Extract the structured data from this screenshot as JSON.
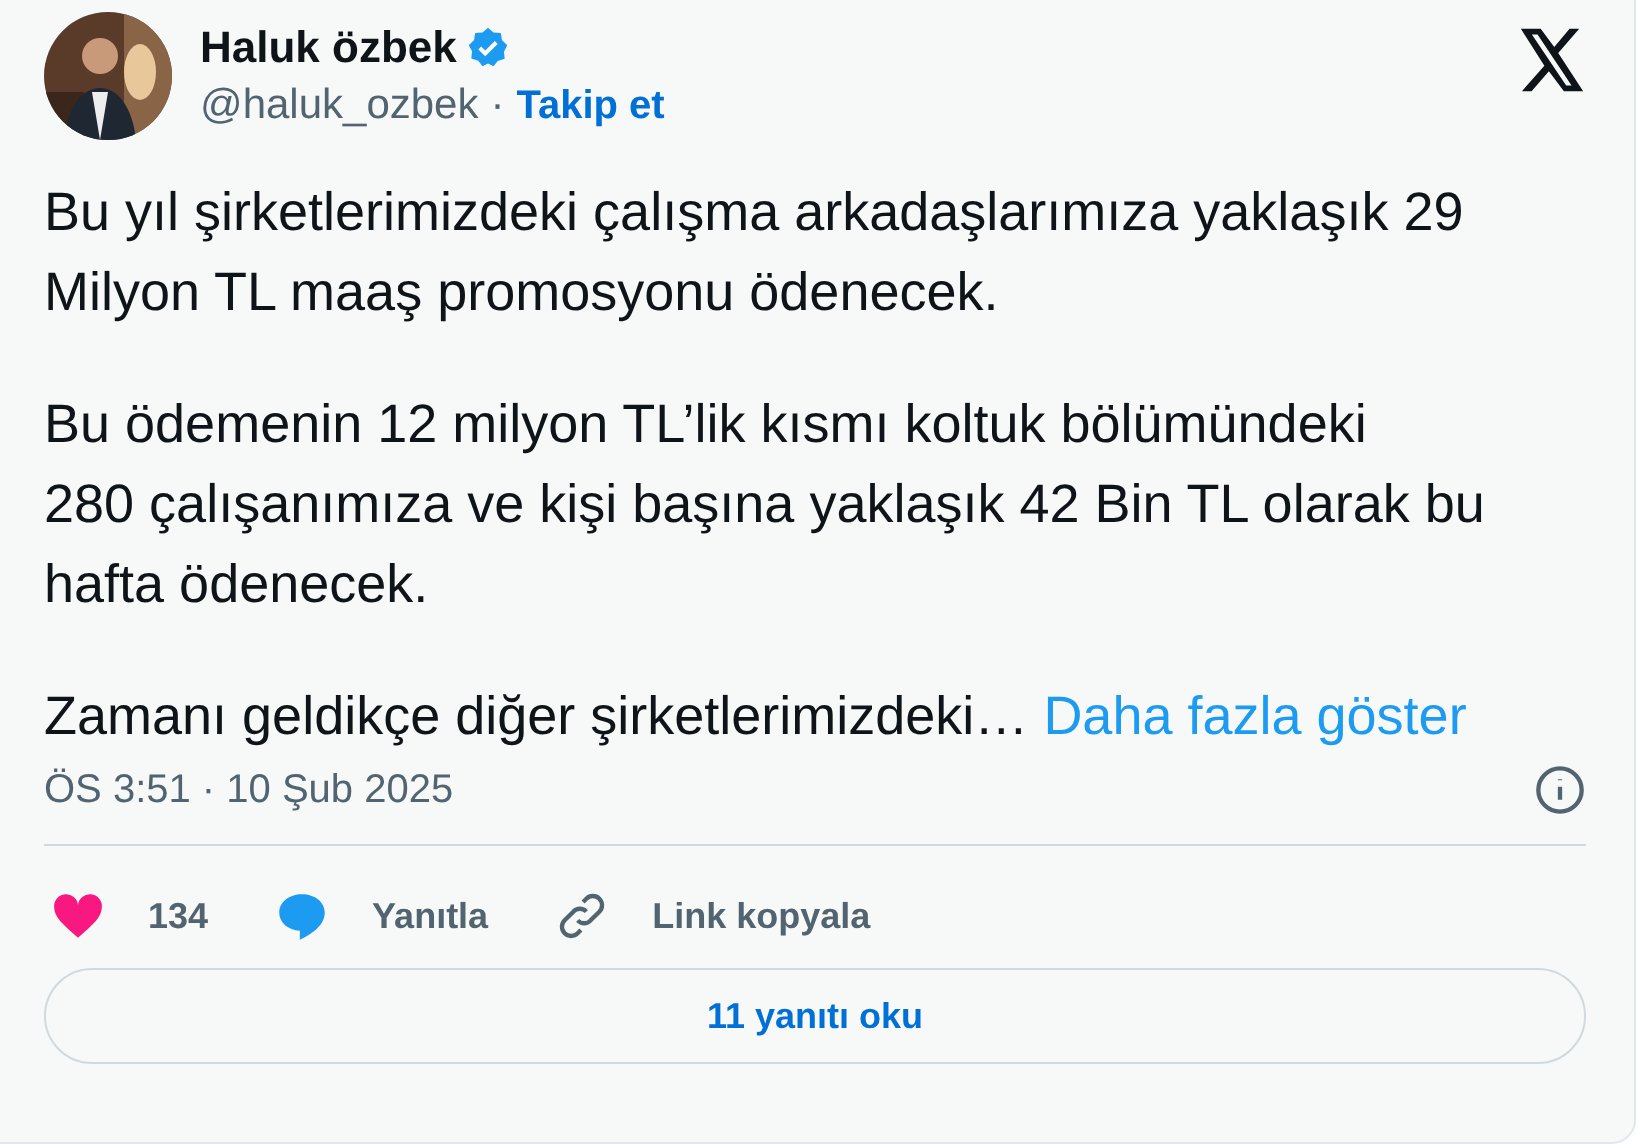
{
  "author": {
    "name": "Haluk özbek",
    "verified": true,
    "handle": "@haluk_ozbek",
    "separator": "·",
    "follow": "Takip et"
  },
  "paragraphs": [
    "Bu yıl şirketlerimizdeki çalışma arkadaşlarımıza yaklaşık 29\nMilyon TL maaş promosyonu ödenecek.",
    "Bu ödemenin 12 milyon TL’lik kısmı koltuk bölümündeki\n280 çalışanımıza ve kişi başına yaklaşık 42 Bin TL olarak bu\nhafta ödenecek."
  ],
  "truncated": {
    "text": "Zamanı geldikçe diğer şirketlerimizdeki…",
    "more": "Daha fazla göster"
  },
  "timestamp": "ÖS 3:51 · 10 Şub 2025",
  "actions": [
    {
      "kind": "like",
      "label": "134"
    },
    {
      "kind": "reply",
      "label": "Yanıtla"
    },
    {
      "kind": "link",
      "label": "Link kopyala"
    }
  ],
  "read_replies": "11 yanıtı oku"
}
